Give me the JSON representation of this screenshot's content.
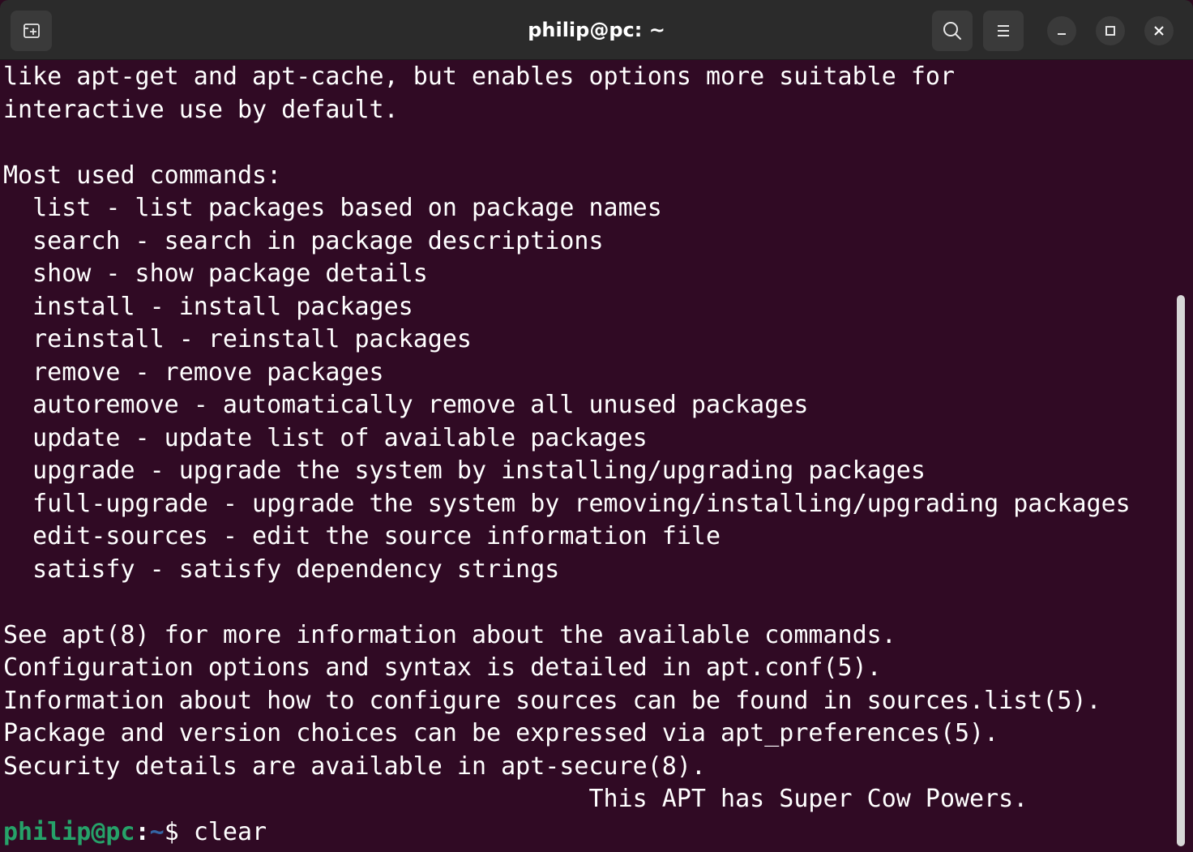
{
  "window": {
    "title": "philip@pc: ~"
  },
  "titlebar": {
    "new_tab_icon": "new-tab-icon",
    "search_icon": "search-icon",
    "menu_icon": "hamburger-menu-icon",
    "minimize_icon": "minimize-icon",
    "maximize_icon": "maximize-icon",
    "close_icon": "close-icon"
  },
  "colors": {
    "terminal_background": "#300a24",
    "titlebar_background": "#2b2b2b",
    "prompt_user": "#26a269",
    "prompt_dir": "#3465a4",
    "text": "#ffffff"
  },
  "terminal": {
    "lines": [
      "like apt-get and apt-cache, but enables options more suitable for",
      "interactive use by default.",
      "",
      "Most used commands:",
      "  list - list packages based on package names",
      "  search - search in package descriptions",
      "  show - show package details",
      "  install - install packages",
      "  reinstall - reinstall packages",
      "  remove - remove packages",
      "  autoremove - automatically remove all unused packages",
      "  update - update list of available packages",
      "  upgrade - upgrade the system by installing/upgrading packages",
      "  full-upgrade - upgrade the system by removing/installing/upgrading packages",
      "  edit-sources - edit the source information file",
      "  satisfy - satisfy dependency strings",
      "",
      "See apt(8) for more information about the available commands.",
      "Configuration options and syntax is detailed in apt.conf(5).",
      "Information about how to configure sources can be found in sources.list(5).",
      "Package and version choices can be expressed via apt_preferences(5).",
      "Security details are available in apt-secure(8).",
      "                                        This APT has Super Cow Powers."
    ],
    "prompt": {
      "user_host": "philip@pc",
      "separator": ":",
      "directory": "~",
      "symbol": "$ ",
      "command": "clear"
    }
  }
}
